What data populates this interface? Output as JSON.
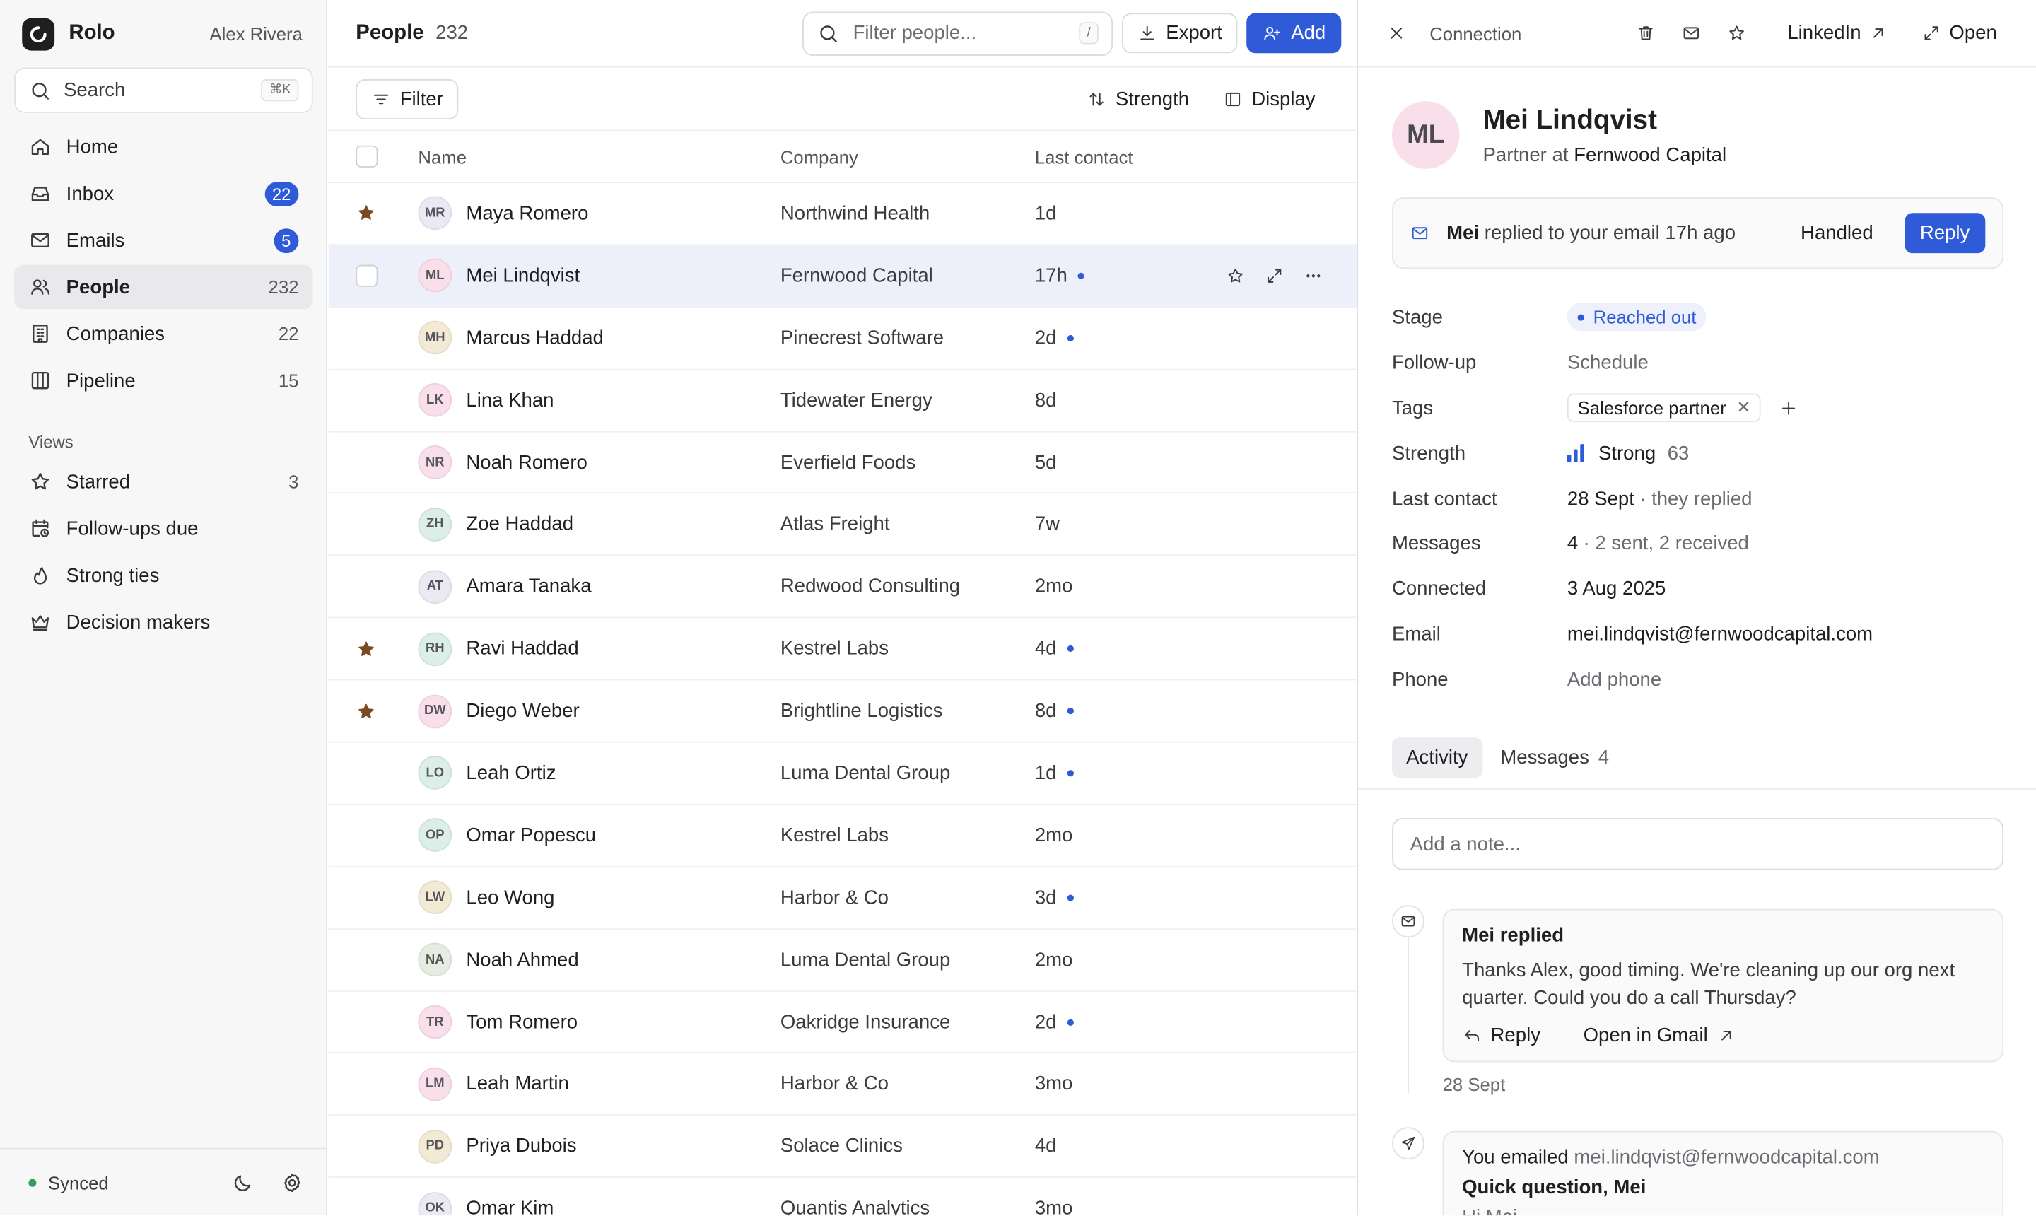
{
  "app": {
    "name": "Rolo",
    "user": "Alex Rivera"
  },
  "colors": {
    "accent": "#2f5bd8",
    "star": "#7a4a22",
    "synced": "#2e9e5b"
  },
  "sidebar": {
    "search_label": "Search",
    "search_shortcut": "⌘K",
    "nav": [
      {
        "label": "Home",
        "icon": "home-icon",
        "count": ""
      },
      {
        "label": "Inbox",
        "icon": "inbox-icon",
        "count": "22",
        "badge": true
      },
      {
        "label": "Emails",
        "icon": "mail-icon",
        "count": "5",
        "badge": true
      },
      {
        "label": "People",
        "icon": "people-icon",
        "count": "232",
        "active": true
      },
      {
        "label": "Companies",
        "icon": "building-icon",
        "count": "22"
      },
      {
        "label": "Pipeline",
        "icon": "columns-icon",
        "count": "15"
      }
    ],
    "views_label": "Views",
    "views": [
      {
        "label": "Starred",
        "icon": "star-icon",
        "count": "3"
      },
      {
        "label": "Follow-ups due",
        "icon": "calendar-clock-icon",
        "count": ""
      },
      {
        "label": "Strong ties",
        "icon": "flame-icon",
        "count": ""
      },
      {
        "label": "Decision makers",
        "icon": "crown-icon",
        "count": ""
      }
    ],
    "footer": {
      "status": "Synced"
    }
  },
  "main": {
    "title": "People",
    "count": "232",
    "filter_placeholder": "Filter people...",
    "filter_shortcut": "/",
    "export_label": "Export",
    "add_label": "Add",
    "filter_button": "Filter",
    "sort_label": "Strength",
    "display_label": "Display",
    "columns": {
      "name": "Name",
      "company": "Company",
      "last_contact": "Last contact"
    },
    "rows": [
      {
        "initials": "MR",
        "name": "Maya Romero",
        "company": "Northwind Health",
        "last": "1d",
        "starred": true,
        "unread": false,
        "bg": "#ece9f6"
      },
      {
        "initials": "ML",
        "name": "Mei Lindqvist",
        "company": "Fernwood Capital",
        "last": "17h",
        "starred": false,
        "unread": true,
        "bg": "#f9dfe9",
        "selected": true
      },
      {
        "initials": "MH",
        "name": "Marcus Haddad",
        "company": "Pinecrest Software",
        "last": "2d",
        "starred": false,
        "unread": true,
        "bg": "#f3ead6"
      },
      {
        "initials": "LK",
        "name": "Lina Khan",
        "company": "Tidewater Energy",
        "last": "8d",
        "starred": false,
        "unread": false,
        "bg": "#f9dfe9"
      },
      {
        "initials": "NR",
        "name": "Noah Romero",
        "company": "Everfield Foods",
        "last": "5d",
        "starred": false,
        "unread": false,
        "bg": "#f9dfe9"
      },
      {
        "initials": "ZH",
        "name": "Zoe Haddad",
        "company": "Atlas Freight",
        "last": "7w",
        "starred": false,
        "unread": false,
        "bg": "#dcefe6"
      },
      {
        "initials": "AT",
        "name": "Amara Tanaka",
        "company": "Redwood Consulting",
        "last": "2mo",
        "starred": false,
        "unread": false,
        "bg": "#e9eaf2"
      },
      {
        "initials": "RH",
        "name": "Ravi Haddad",
        "company": "Kestrel Labs",
        "last": "4d",
        "starred": true,
        "unread": true,
        "bg": "#dcefe6"
      },
      {
        "initials": "DW",
        "name": "Diego Weber",
        "company": "Brightline Logistics",
        "last": "8d",
        "starred": true,
        "unread": true,
        "bg": "#f9dfe9"
      },
      {
        "initials": "LO",
        "name": "Leah Ortiz",
        "company": "Luma Dental Group",
        "last": "1d",
        "starred": false,
        "unread": true,
        "bg": "#dcefe6"
      },
      {
        "initials": "OP",
        "name": "Omar Popescu",
        "company": "Kestrel Labs",
        "last": "2mo",
        "starred": false,
        "unread": false,
        "bg": "#dcefe6"
      },
      {
        "initials": "LW",
        "name": "Leo Wong",
        "company": "Harbor & Co",
        "last": "3d",
        "starred": false,
        "unread": true,
        "bg": "#f3ead6"
      },
      {
        "initials": "NA",
        "name": "Noah Ahmed",
        "company": "Luma Dental Group",
        "last": "2mo",
        "starred": false,
        "unread": false,
        "bg": "#e6ede0"
      },
      {
        "initials": "TR",
        "name": "Tom Romero",
        "company": "Oakridge Insurance",
        "last": "2d",
        "starred": false,
        "unread": true,
        "bg": "#f9dfe9"
      },
      {
        "initials": "LM",
        "name": "Leah Martin",
        "company": "Harbor & Co",
        "last": "3mo",
        "starred": false,
        "unread": false,
        "bg": "#f9dfe9"
      },
      {
        "initials": "PD",
        "name": "Priya Dubois",
        "company": "Solace Clinics",
        "last": "4d",
        "starred": false,
        "unread": false,
        "bg": "#f3ead6"
      },
      {
        "initials": "OK",
        "name": "Omar Kim",
        "company": "Quantis Analytics",
        "last": "3mo",
        "starred": false,
        "unread": false,
        "bg": "#e9eaf2"
      }
    ]
  },
  "detail": {
    "header_title": "Connection",
    "linkedin_label": "LinkedIn",
    "open_label": "Open",
    "initials": "ML",
    "name": "Mei Lindqvist",
    "role": "Partner",
    "role_at": "at",
    "company": "Fernwood Capital",
    "notice": {
      "who": "Mei",
      "text": "replied to your email 17h ago",
      "handled": "Handled",
      "reply": "Reply"
    },
    "props": {
      "stage_label": "Stage",
      "stage": "Reached out",
      "followup_label": "Follow-up",
      "followup": "Schedule",
      "tags_label": "Tags",
      "tag": "Salesforce partner",
      "strength_label": "Strength",
      "strength": "Strong",
      "strength_score": "63",
      "last_label": "Last contact",
      "last_date": "28 Sept",
      "last_note": "· they replied",
      "messages_label": "Messages",
      "messages_count": "4",
      "messages_note": "· 2 sent, 2 received",
      "connected_label": "Connected",
      "connected": "3 Aug 2025",
      "email_label": "Email",
      "email": "mei.lindqvist@fernwoodcapital.com",
      "phone_label": "Phone",
      "phone": "Add phone"
    },
    "tabs": {
      "activity": "Activity",
      "messages": "Messages",
      "messages_count": "4"
    },
    "note_placeholder": "Add a note...",
    "timeline": {
      "item1": {
        "title": "Mei replied",
        "body": "Thanks Alex, good timing. We're cleaning up our org next quarter. Could you do a call Thursday?",
        "reply": "Reply",
        "open_gmail": "Open in Gmail",
        "date": "28 Sept"
      },
      "item2": {
        "prefix": "You emailed",
        "to": "mei.lindqvist@fernwoodcapital.com",
        "subject": "Quick question, Mei",
        "preview": "Hi Mei,"
      }
    }
  }
}
